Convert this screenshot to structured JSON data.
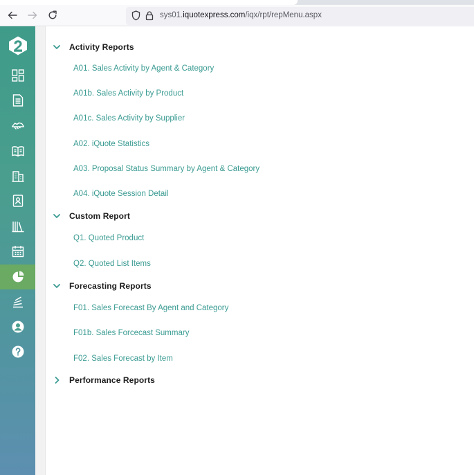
{
  "browser": {
    "url_prefix": "sys01.",
    "url_domain": "iquotexpress.com",
    "url_path": "/iqx/rpt/repMenu.aspx",
    "icons": [
      "back-arrow-icon",
      "forward-arrow-icon",
      "reload-icon",
      "shield-icon",
      "lock-icon"
    ]
  },
  "sidebar": {
    "logo": "iquote-logo",
    "items": [
      {
        "icon": "dashboard-icon"
      },
      {
        "icon": "document-icon"
      },
      {
        "icon": "handshake-icon"
      },
      {
        "icon": "catalog-book-icon"
      },
      {
        "icon": "building-icon"
      },
      {
        "icon": "contact-card-icon"
      },
      {
        "icon": "library-icon"
      },
      {
        "icon": "calendar-icon"
      },
      {
        "icon": "reports-pie-icon",
        "active": true
      },
      {
        "icon": "stack-icon"
      },
      {
        "icon": "user-circle-icon"
      },
      {
        "icon": "help-icon"
      }
    ],
    "active_color": "#6aaa62"
  },
  "groups": [
    {
      "title": "Activity Reports",
      "expanded": true,
      "items": [
        "A01. Sales Activity by Agent & Category",
        "A01b. Sales Activity by Product",
        "A01c. Sales Activity by Supplier",
        "A02. iQuote Statistics",
        "A03. Proposal Status Summary by Agent & Category",
        "A04. iQuote Session Detail"
      ]
    },
    {
      "title": "Custom Report",
      "expanded": true,
      "items": [
        "Q1. Quoted Product",
        "Q2. Quoted List Items"
      ]
    },
    {
      "title": "Forecasting Reports",
      "expanded": true,
      "items": [
        "F01. Sales Forecast By Agent and Category",
        "F01b. Sales Forcecast Summary",
        "F02. Sales Forecast by Item"
      ]
    },
    {
      "title": "Performance Reports",
      "expanded": false,
      "items": []
    }
  ],
  "colors": {
    "link": "#3a9b92",
    "chevron": "#3a9b92",
    "heading": "#1d1d1d"
  }
}
